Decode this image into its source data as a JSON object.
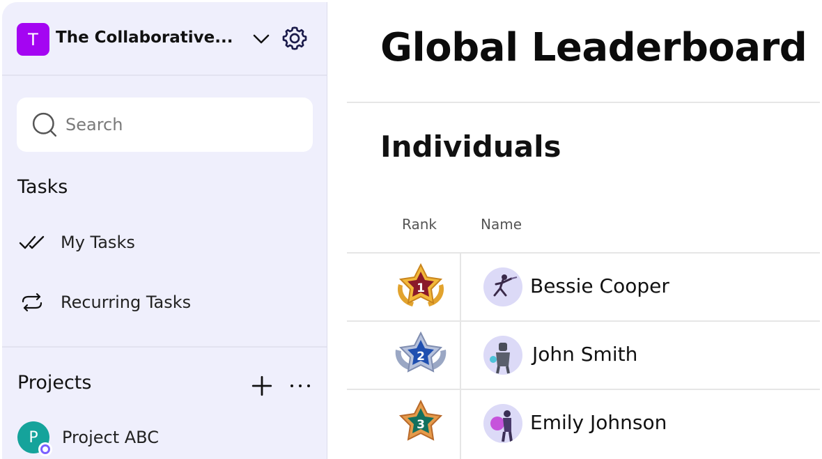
{
  "workspace": {
    "initial": "T",
    "name": "The Collaborative...",
    "color": "#a405f2"
  },
  "search": {
    "placeholder": "Search"
  },
  "tasks": {
    "title": "Tasks",
    "items": [
      {
        "label": "My Tasks",
        "icon": "double-check-icon"
      },
      {
        "label": "Recurring Tasks",
        "icon": "repeat-icon"
      }
    ]
  },
  "projects": {
    "title": "Projects",
    "items": [
      {
        "initial": "P",
        "label": "Project ABC",
        "color": "#15a39b"
      }
    ]
  },
  "main": {
    "title": "Global Leaderboard",
    "section": "Individuals",
    "columns": {
      "rank": "Rank",
      "name": "Name"
    },
    "rows": [
      {
        "rank": "1",
        "name": "Bessie Cooper",
        "badge_color": "#8a1a2a"
      },
      {
        "rank": "2",
        "name": "John Smith",
        "badge_color": "#1f4fb0"
      },
      {
        "rank": "3",
        "name": "Emily Johnson",
        "badge_color": "#12705e"
      }
    ]
  }
}
